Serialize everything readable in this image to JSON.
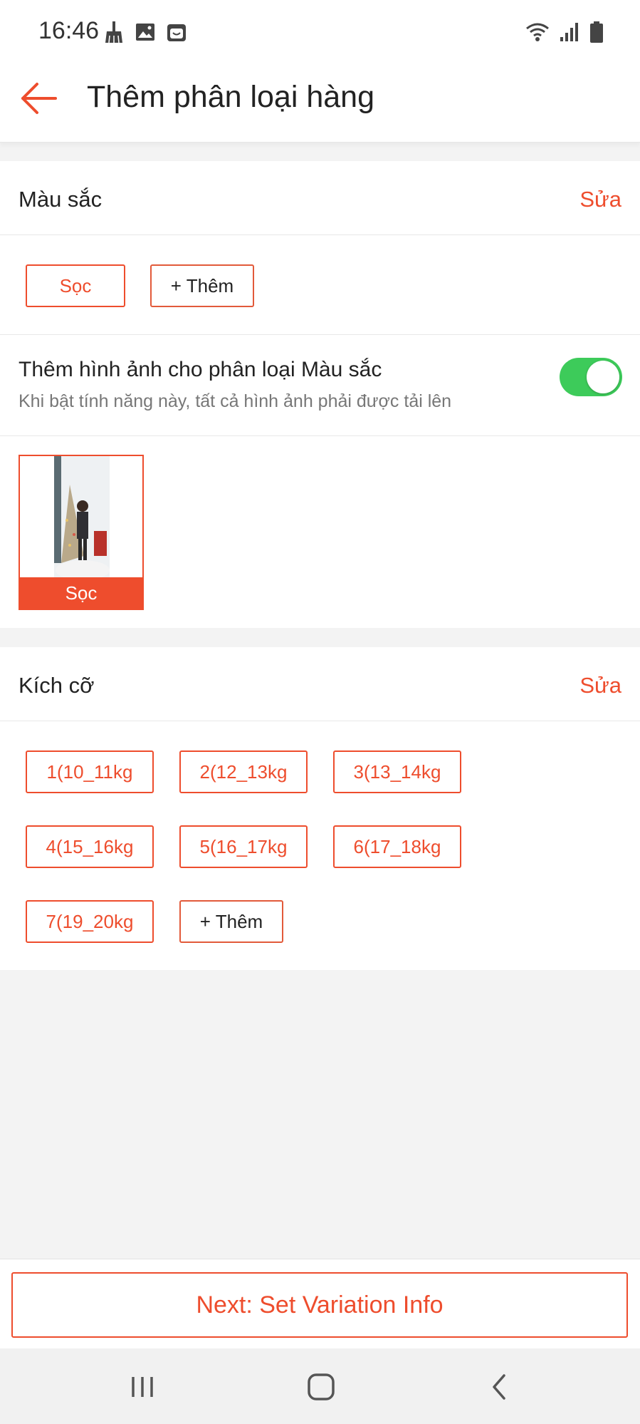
{
  "status_bar": {
    "time": "16:46",
    "left_icons": [
      "broom-icon",
      "image-icon",
      "shop-bag-icon"
    ],
    "right_icons": [
      "wifi-icon",
      "signal-icon",
      "battery-icon"
    ]
  },
  "header": {
    "title": "Thêm phân loại hàng",
    "back_icon": "arrow-left-icon"
  },
  "color_section": {
    "title": "Màu sắc",
    "edit_label": "Sửa",
    "options": [
      "Sọc"
    ],
    "add_label": "+ Thêm",
    "image_toggle": {
      "title": "Thêm hình ảnh cho phân loại Màu sắc",
      "description": "Khi bật tính năng này, tất cả hình ảnh phải được tải lên",
      "enabled": true
    },
    "images": [
      {
        "caption": "Sọc"
      }
    ]
  },
  "size_section": {
    "title": "Kích cỡ",
    "edit_label": "Sửa",
    "options": [
      "1(10_11kg",
      "2(12_13kg",
      "3(13_14kg",
      "4(15_16kg",
      "5(16_17kg",
      "6(17_18kg",
      "7(19_20kg"
    ],
    "add_label": "+ Thêm"
  },
  "footer": {
    "next_label": "Next: Set Variation Info"
  },
  "nav": {
    "icons": [
      "recent-apps-icon",
      "home-icon",
      "back-nav-icon"
    ]
  },
  "colors": {
    "accent": "#ee4d2d",
    "toggle_on": "#3dcb5a"
  }
}
